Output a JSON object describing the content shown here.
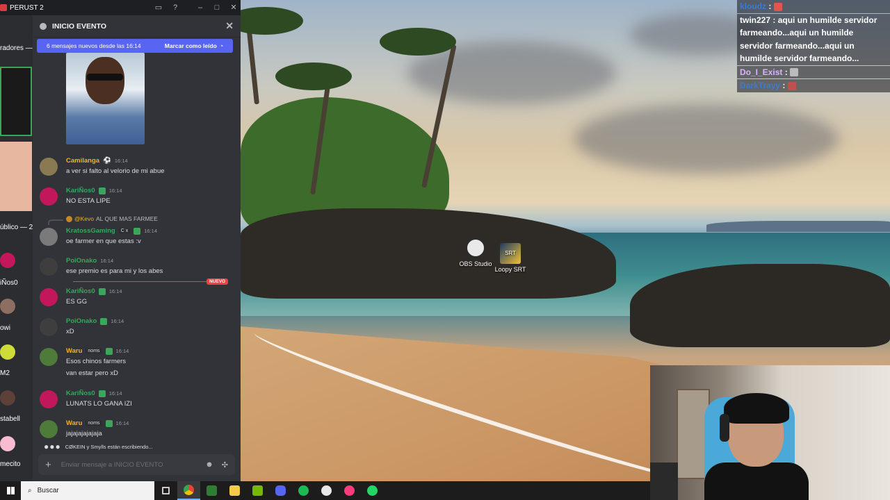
{
  "window": {
    "title": "PERUST 2"
  },
  "thread": {
    "title": "INICIO EVENTO",
    "banner_text": "6 mensajes nuevos desde las 16:14",
    "mark_read": "Marcar como leído",
    "new_label": "NUEVO",
    "typing_text": "CØKEIN y Smylls están escribiendo...",
    "composer_placeholder": "Enviar mensaje a INICIO EVENTO"
  },
  "left_strip": {
    "labels": [
      "radores —",
      "úblico — 2",
      "iÑos0",
      "owi",
      "M2",
      "stabell",
      "mecito"
    ]
  },
  "messages": [
    {
      "name": "Camilanga",
      "time": "16:14",
      "text": "a ver si falto al velorio de mi abue",
      "color": "#f0b232"
    },
    {
      "name": "KariÑos0",
      "time": "16:14",
      "text": "NO ESTA LIPE",
      "color": "#3ba55c"
    },
    {
      "name": "KratossGaming",
      "time": "16:14",
      "text": "oe farmer en que estas :v",
      "color": "#3ba55c",
      "tag": "C x",
      "reply_user": "@Kevo",
      "reply_text": "AL QUE MAS FARMEE"
    },
    {
      "name": "PoiOnako",
      "time": "16:14",
      "text": "ese premio es para mi y los abes",
      "color": "#3ba55c"
    },
    {
      "name": "KariÑos0",
      "time": "16:14",
      "text": "ES GG",
      "color": "#3ba55c"
    },
    {
      "name": "PoiOnako",
      "time": "16:14",
      "text": "xD",
      "color": "#3ba55c"
    },
    {
      "name": "Waru",
      "time": "16:14",
      "text": "Esos chinos farmers",
      "text2": "van estar pero xD",
      "color": "#f0b232",
      "tag": "noms"
    },
    {
      "name": "KariÑos0",
      "time": "16:14",
      "text": "LUNATS LO GANA IZI",
      "color": "#3ba55c"
    },
    {
      "name": "Waru",
      "time": "16:14",
      "text": "jajajajajajaja",
      "color": "#f0b232",
      "tag": "noms"
    }
  ],
  "desktop_icons": [
    {
      "label": "OBS Studio"
    },
    {
      "label": "Loopy SRT"
    }
  ],
  "stream_chat": [
    {
      "user": "kloudz",
      "text": "",
      "user_color": "#3a7bd5"
    },
    {
      "user": "twin227",
      "text": "aqui un humilde servidor farmeando...aqui un humilde servidor farmeando...aqui un humilde servidor farmeando...",
      "user_color": "#ffffff"
    },
    {
      "user": "Do_I_Exist",
      "text": "",
      "user_color": "#d8b4ff"
    },
    {
      "user": "DarkTrayy",
      "text": "",
      "user_color": "#3a7bd5"
    }
  ],
  "taskbar": {
    "search_placeholder": "Buscar"
  },
  "colors": {
    "discord_bg": "#313338",
    "blurple": "#5865f2",
    "new_red": "#f23f42"
  }
}
